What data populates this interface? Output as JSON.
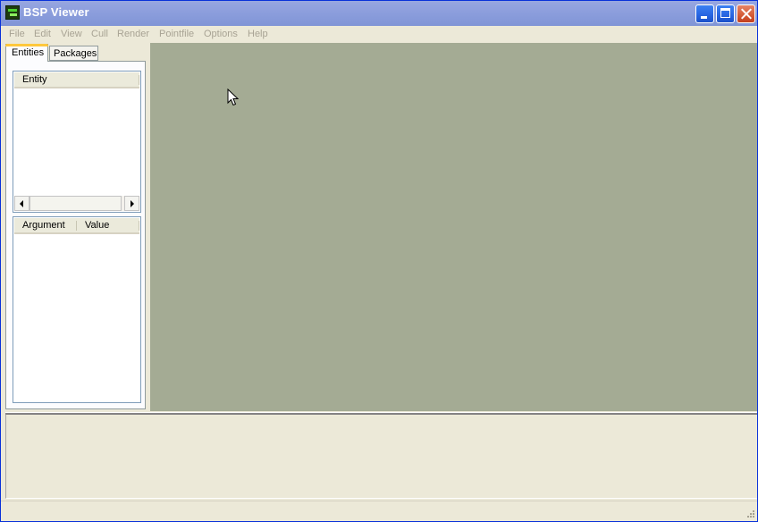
{
  "window": {
    "title": "BSP Viewer"
  },
  "menu": [
    "File",
    "Edit",
    "View",
    "Cull",
    "Render",
    "Pointfile",
    "Options",
    "Help"
  ],
  "tabs": {
    "entities": "Entities",
    "packages": "Packages"
  },
  "entity_list": {
    "header": "Entity"
  },
  "argument_list": {
    "headers": [
      "Argument",
      "Value"
    ]
  },
  "colors": {
    "title_bar": "#8b9ddc",
    "viewport": "#a4ab94",
    "face": "#ece9d8",
    "disabled_text": "#a8a394"
  },
  "icons": [
    "app-icon",
    "minimize-icon",
    "maximize-icon",
    "close-icon",
    "arrow-left-icon",
    "arrow-right-icon",
    "mouse-cursor-icon",
    "size-grip-icon"
  ]
}
